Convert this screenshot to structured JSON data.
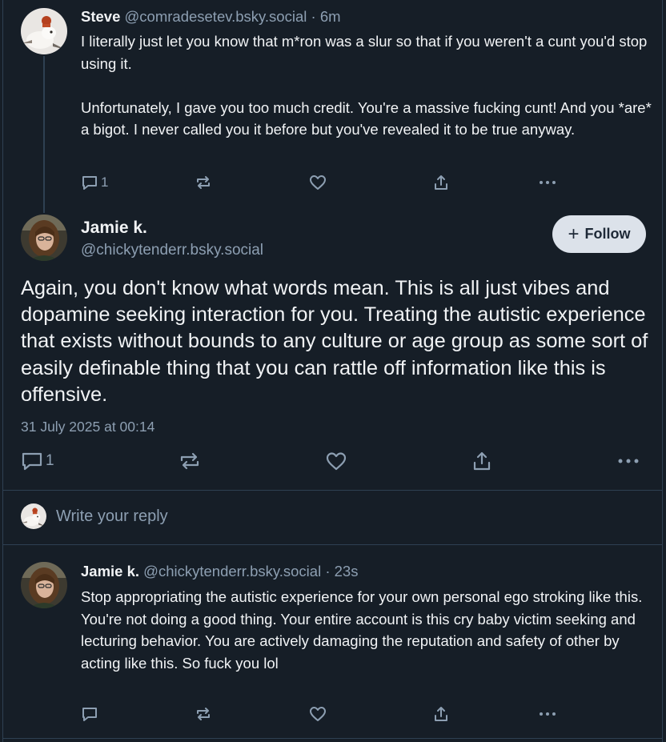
{
  "parent_post": {
    "author_name": "Steve",
    "author_handle": "@comradesetev.bsky.social",
    "time_ago": "· 6m",
    "body": "I literally just let you know that m*ron was a slur so that if you weren't a cunt you'd stop using it.\n\nUnfortunately, I gave you too much credit. You're a massive fucking cunt! And you *are* a bigot. I never called you it before but you've revealed it to be true anyway.",
    "reply_count": "1"
  },
  "main_post": {
    "author_name": "Jamie k.",
    "author_handle": "@chickytenderr.bsky.social",
    "follow_label": "Follow",
    "follow_plus": "+",
    "body": "Again, you don't know what words mean. This is all just vibes and dopamine seeking interaction for you. Treating the autistic experience that exists without bounds to any culture or age group as some sort of easily definable thing that you can rattle off information like this is offensive.",
    "timestamp": "31 July 2025 at 00:14",
    "reply_count": "1"
  },
  "reply_composer": {
    "placeholder": "Write your reply"
  },
  "reply_post": {
    "author_name": "Jamie k.",
    "author_handle": "@chickytenderr.bsky.social",
    "time_ago": "· 23s",
    "body": "Stop appropriating the autistic experience for your own personal ego stroking like this. You're not doing a good thing. Your entire account is this cry baby victim seeking and lecturing behavior. You are actively damaging the reputation and safety of other by acting like this. So fuck you lol"
  },
  "icons": {
    "reply": "reply-icon",
    "repost": "repost-icon",
    "like": "like-icon",
    "share": "share-icon",
    "more": "more-icon"
  },
  "colors": {
    "background": "#161e27",
    "text": "#f1f3f5",
    "muted": "#8d9fb2",
    "border": "#2e4052",
    "follow_bg": "#dce2ea"
  }
}
